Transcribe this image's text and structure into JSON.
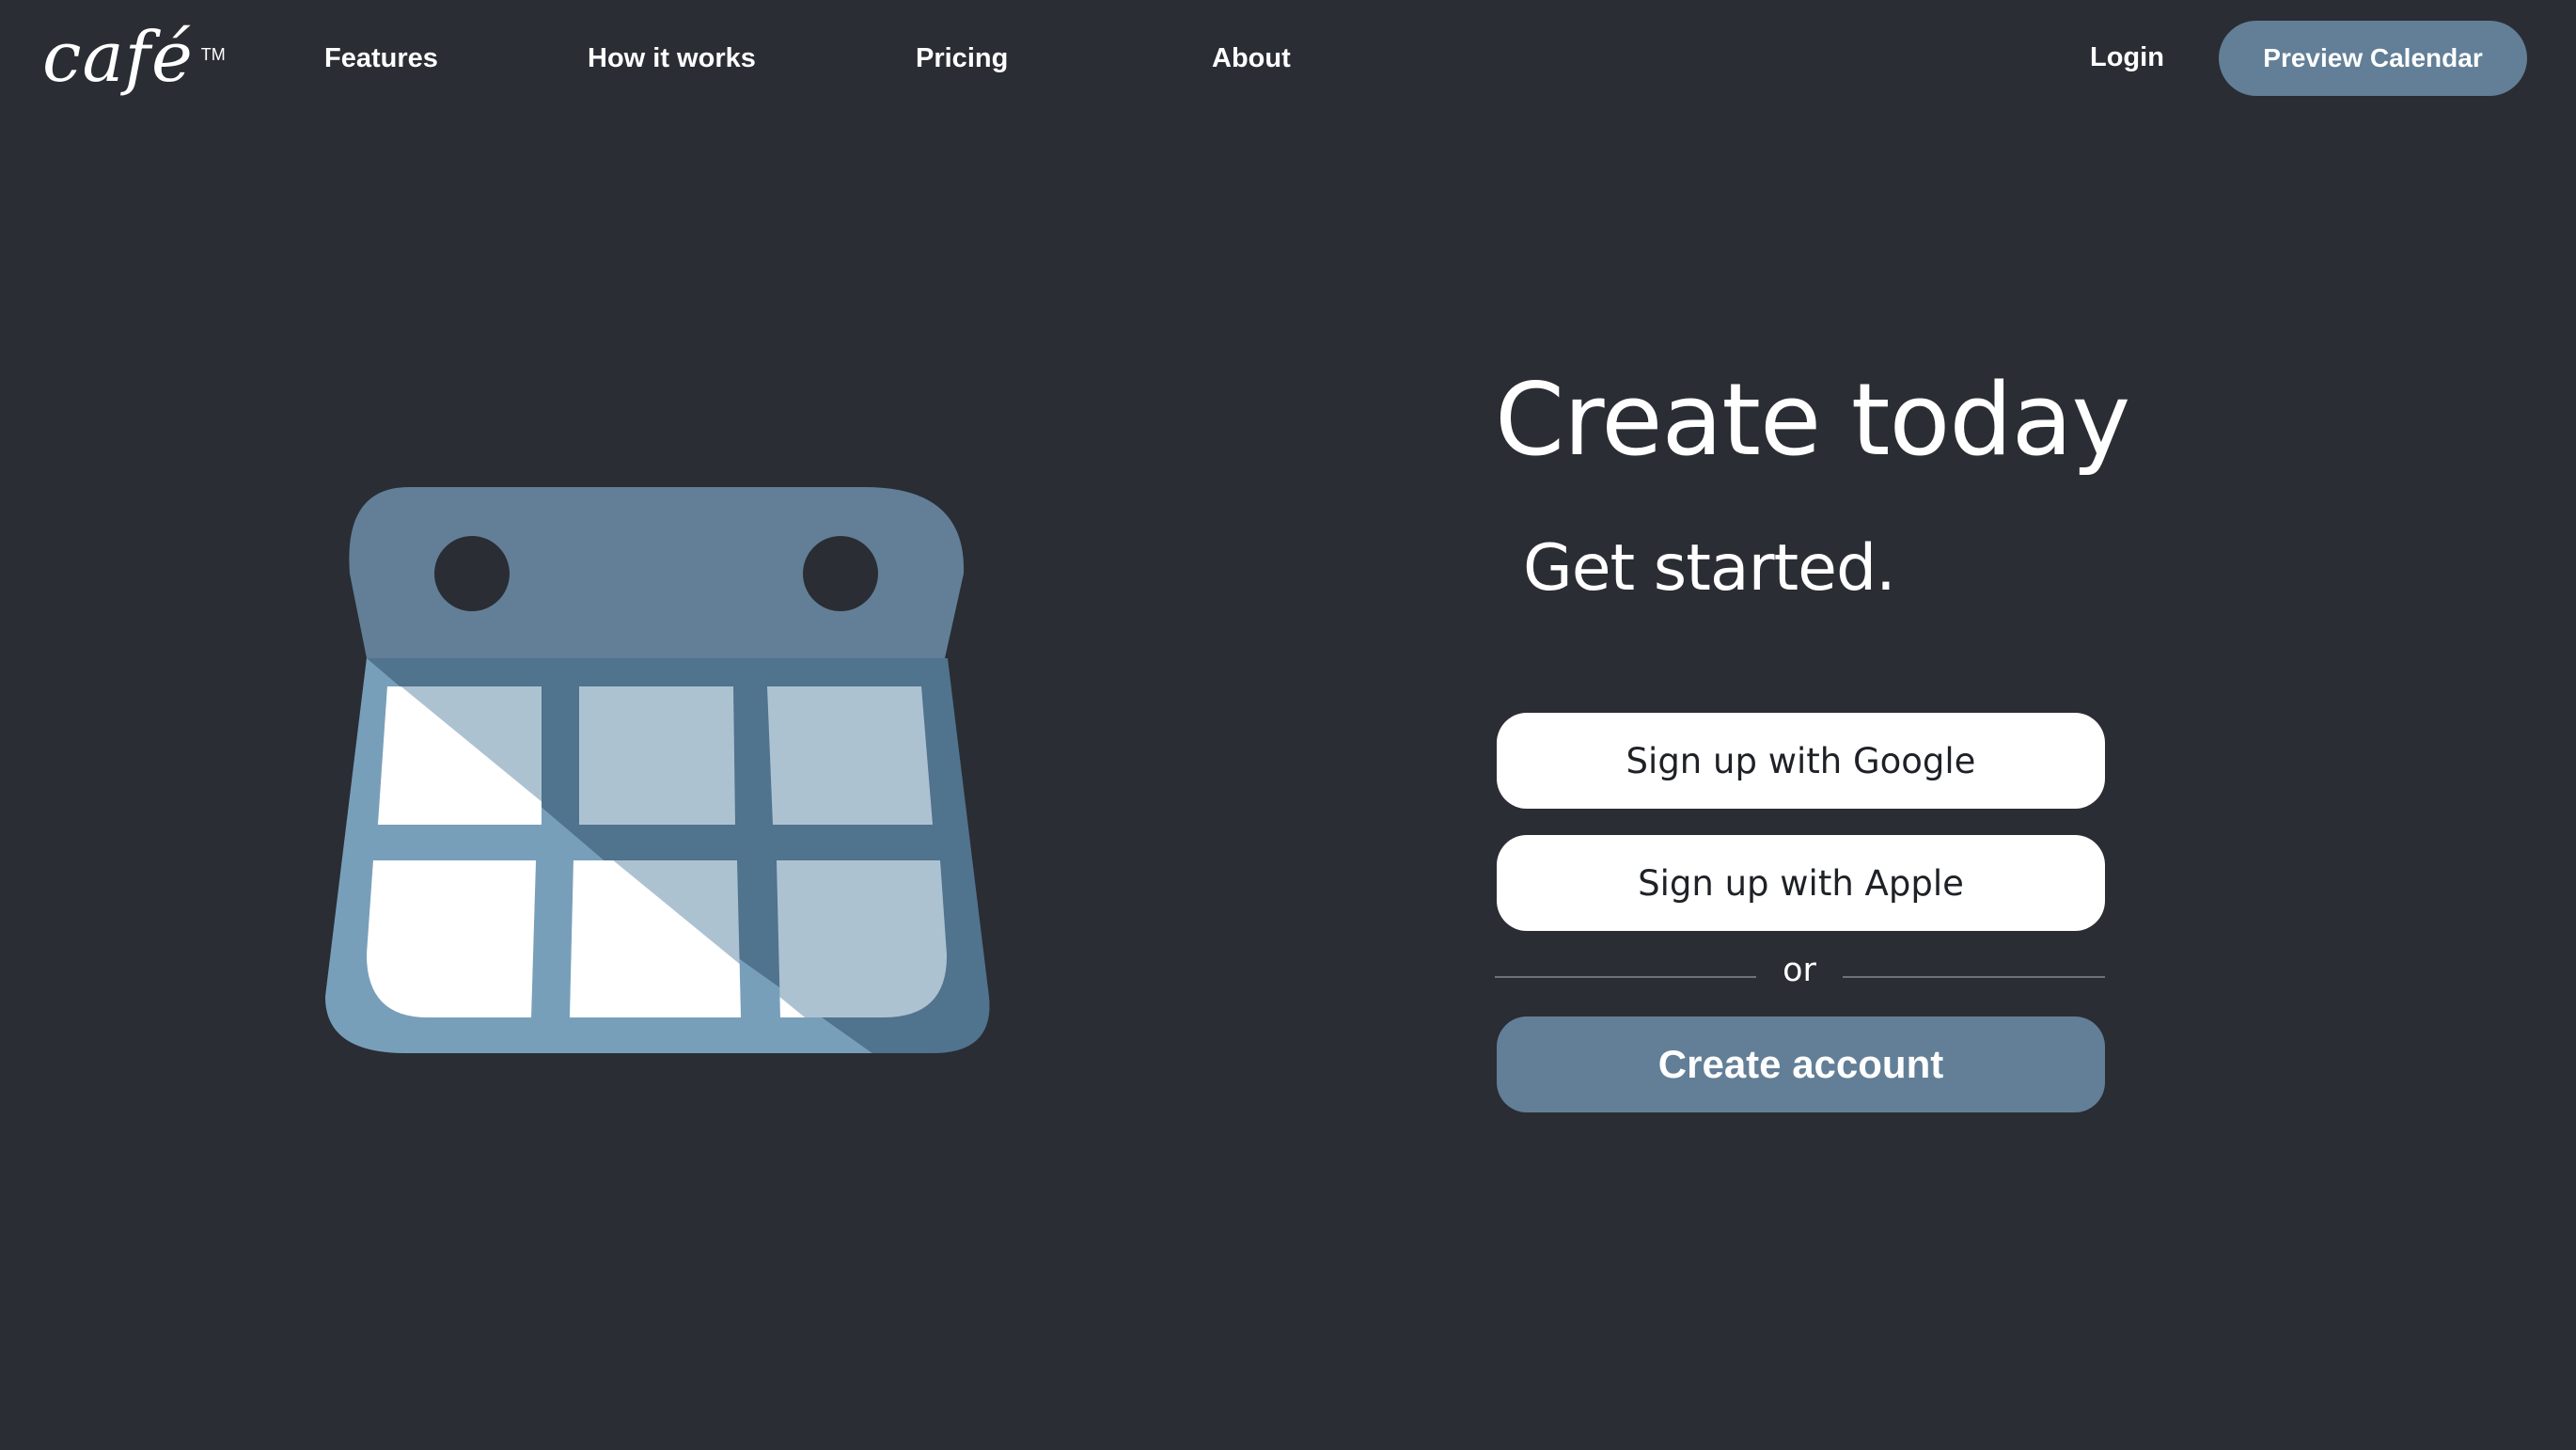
{
  "brand": {
    "logo_text": "café",
    "trademark": "TM"
  },
  "nav": {
    "links": [
      "Features",
      "How it works",
      "Pricing",
      "About"
    ],
    "login_label": "Login",
    "preview_label": "Preview Calendar"
  },
  "hero": {
    "title": "Create today",
    "subtitle": "Get started.",
    "illustration_icon": "calendar-icon"
  },
  "signup": {
    "google_label": "Sign up with Google",
    "apple_label": "Sign up with Apple",
    "divider_text": "or",
    "create_label": "Create account"
  },
  "colors": {
    "background": "#2a2d33",
    "accent": "#627f97",
    "button_light": "#ffffff"
  }
}
